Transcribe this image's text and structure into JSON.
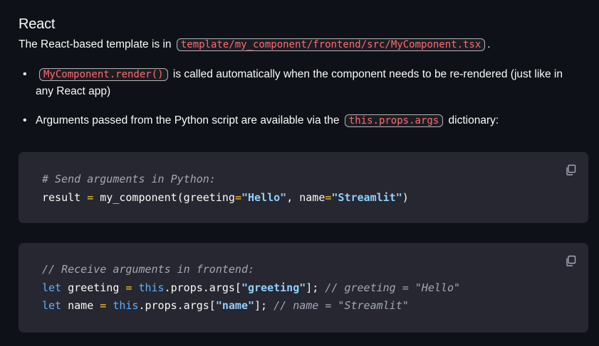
{
  "section": {
    "heading": "React",
    "intro_prefix": "The React-based template is in",
    "intro_code": "template/my_component/frontend/src/MyComponent.tsx",
    "intro_suffix": "."
  },
  "bullets": [
    {
      "code": "MyComponent.render()",
      "text": "is called automatically when the component needs to be re-rendered (just like in any React app)"
    },
    {
      "prefix": "Arguments passed from the Python script are available via the",
      "code": "this.props.args",
      "suffix": "dictionary:"
    }
  ],
  "code_blocks": [
    {
      "copy_icon": "copy-icon",
      "comment": "# Send arguments in Python:",
      "line2": {
        "var": "result",
        "eq": "=",
        "fn": "my_component(greeting",
        "eq2": "=",
        "arg1": "\"Hello\"",
        "mid": ", name",
        "eq3": "=",
        "arg2": "\"Streamlit\"",
        "end": ")"
      }
    },
    {
      "copy_icon": "copy-icon",
      "comment": "// Receive arguments in frontend:",
      "line2": {
        "kw": "let",
        "var": "greeting",
        "eq": "=",
        "this": "this",
        "rest": ".props.args[",
        "key": "\"greeting\"",
        "close": "];",
        "cmt": "// greeting = \"Hello\""
      },
      "line3": {
        "kw": "let",
        "var": "name",
        "eq": "=",
        "this": "this",
        "rest": ".props.args[",
        "key": "\"name\"",
        "close": "];",
        "cmt": "// name = \"Streamlit\""
      }
    }
  ]
}
